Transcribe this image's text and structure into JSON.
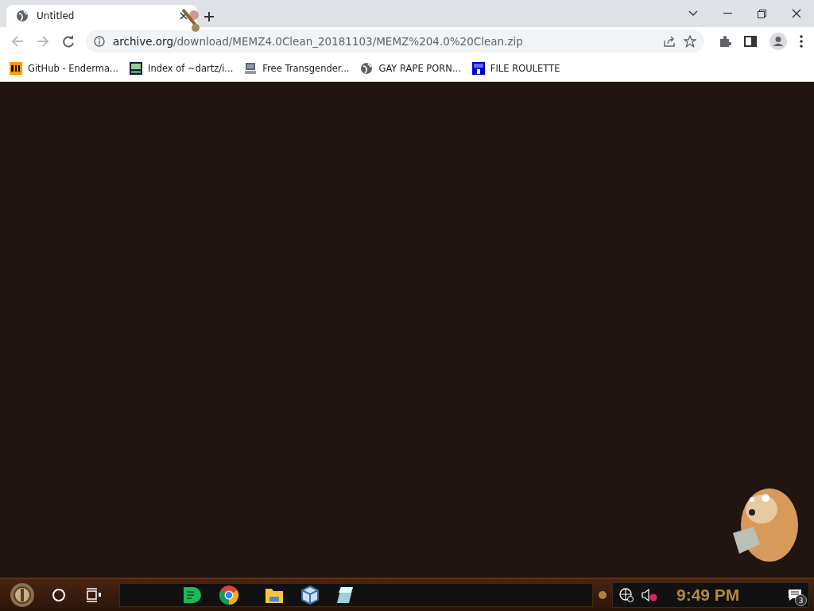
{
  "tabs": [
    {
      "title": "Untitled",
      "selected": true
    }
  ],
  "address": {
    "host": "archive.org",
    "path": "/download/MEMZ4.0Clean_20181103/MEMZ%204.0%20Clean.zip"
  },
  "bookmarks": [
    {
      "label": "GitHub - Enderma...",
      "kind": "ph"
    },
    {
      "label": "Index of ~dartz/i...",
      "kind": "grid"
    },
    {
      "label": "Free Transgender...",
      "kind": "computer"
    },
    {
      "label": "GAY RAPE PORN...",
      "kind": "globe"
    },
    {
      "label": "FILE ROULETTE",
      "kind": "mft"
    }
  ],
  "taskbar": {
    "clock": "9:49 PM",
    "notification_count": "3"
  }
}
